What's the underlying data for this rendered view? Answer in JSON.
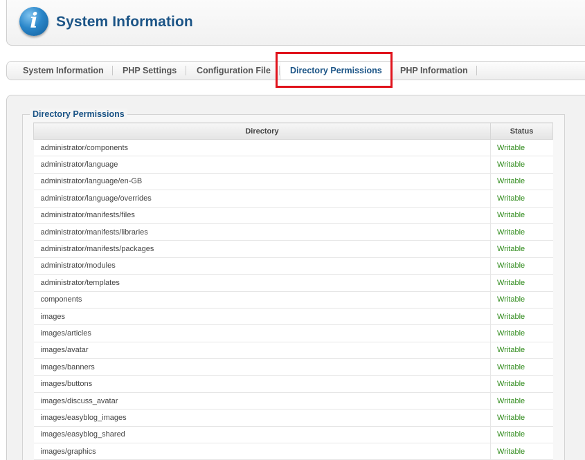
{
  "header": {
    "icon": "info-icon",
    "title": "System Information"
  },
  "tabs": [
    {
      "label": "System Information",
      "active": false
    },
    {
      "label": "PHP Settings",
      "active": false
    },
    {
      "label": "Configuration File",
      "active": false
    },
    {
      "label": "Directory Permissions",
      "active": true
    },
    {
      "label": "PHP Information",
      "active": false
    }
  ],
  "colors": {
    "title": "#1b5486",
    "writable": "#2e8a1a",
    "highlight": "#e0121b"
  },
  "section": {
    "legend": "Directory Permissions",
    "columns": {
      "directory": "Directory",
      "status": "Status"
    },
    "rows": [
      {
        "directory": "administrator/components",
        "status": "Writable"
      },
      {
        "directory": "administrator/language",
        "status": "Writable"
      },
      {
        "directory": "administrator/language/en-GB",
        "status": "Writable"
      },
      {
        "directory": "administrator/language/overrides",
        "status": "Writable"
      },
      {
        "directory": "administrator/manifests/files",
        "status": "Writable"
      },
      {
        "directory": "administrator/manifests/libraries",
        "status": "Writable"
      },
      {
        "directory": "administrator/manifests/packages",
        "status": "Writable"
      },
      {
        "directory": "administrator/modules",
        "status": "Writable"
      },
      {
        "directory": "administrator/templates",
        "status": "Writable"
      },
      {
        "directory": "components",
        "status": "Writable"
      },
      {
        "directory": "images",
        "status": "Writable"
      },
      {
        "directory": "images/articles",
        "status": "Writable"
      },
      {
        "directory": "images/avatar",
        "status": "Writable"
      },
      {
        "directory": "images/banners",
        "status": "Writable"
      },
      {
        "directory": "images/buttons",
        "status": "Writable"
      },
      {
        "directory": "images/discuss_avatar",
        "status": "Writable"
      },
      {
        "directory": "images/easyblog_images",
        "status": "Writable"
      },
      {
        "directory": "images/easyblog_shared",
        "status": "Writable"
      },
      {
        "directory": "images/graphics",
        "status": "Writable"
      }
    ]
  }
}
